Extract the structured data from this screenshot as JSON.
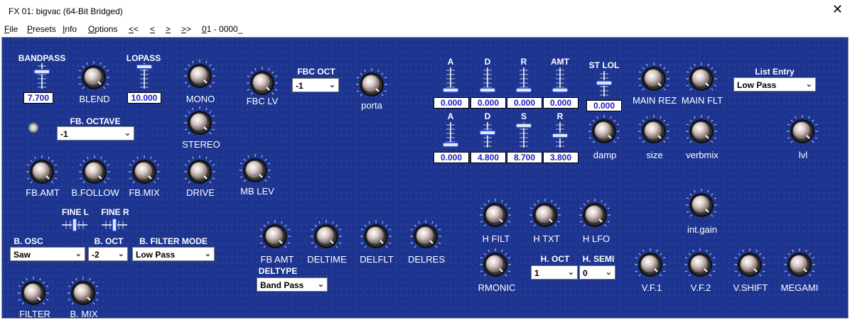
{
  "window": {
    "title": "FX 01: bigvac (64-Bit Bridged)"
  },
  "menu": {
    "file": "File",
    "presets": "Presets",
    "info": "Info",
    "options": "Options",
    "prev2": "<<",
    "prev": "<",
    "next": ">",
    "next2": ">>",
    "preset_num": "01 - 0000_"
  },
  "sliders": {
    "bandpass": {
      "label": "BANDPASS",
      "value": "7.700"
    },
    "lopass": {
      "label": "LOPASS",
      "value": "10.000"
    },
    "env1_a": {
      "label": "A",
      "value": "0.000"
    },
    "env1_d": {
      "label": "D",
      "value": "0.000"
    },
    "env1_r": {
      "label": "R",
      "value": "0.000"
    },
    "env1_amt": {
      "label": "AMT",
      "value": "0.000"
    },
    "env2_a": {
      "label": "A",
      "value": "0.000"
    },
    "env2_d": {
      "label": "D",
      "value": "4.800"
    },
    "env2_s": {
      "label": "S",
      "value": "8.700"
    },
    "env2_r": {
      "label": "R",
      "value": "3.800"
    },
    "st_lol": {
      "label": "ST LOL",
      "value": "0.000"
    },
    "fine_l": {
      "label": "FINE L"
    },
    "fine_r": {
      "label": "FINE R"
    }
  },
  "knobs": {
    "blend": "BLEND",
    "mono": "MONO",
    "stereo": "STEREO",
    "fbc_lv": "FBC LV",
    "porta": "porta",
    "fb_amt": "FB.AMT",
    "b_follow": "B.FOLLOW",
    "fb_mix": "FB.MIX",
    "drive": "DRIVE",
    "mb_lev": "MB LEV",
    "filter": "FILTER",
    "b_mix": "B. MIX",
    "fb_amt2": "FB AMT",
    "deltime": "DELTIME",
    "delflt": "DELFLT",
    "delres": "DELRES",
    "h_filt": "H FILT",
    "h_txt": "H TXT",
    "h_lfo": "H LFO",
    "rmonic": "RMONIC",
    "main_rez": "MAIN REZ",
    "main_flt": "MAIN FLT",
    "damp": "damp",
    "size": "size",
    "verbmix": "verbmix",
    "lvl": "lvl",
    "int_gain": "int.gain",
    "vf1": "V.F.1",
    "vf2": "V.F.2",
    "vshift": "V.SHIFT",
    "megami": "MEGAMI"
  },
  "selects": {
    "fbc_oct": {
      "label": "FBC OCT",
      "value": "-1"
    },
    "fb_octave": {
      "label": "FB. OCTAVE",
      "value": "-1"
    },
    "b_osc": {
      "label": "B. OSC",
      "value": "Saw"
    },
    "b_oct": {
      "label": "B. OCT",
      "value": "-2"
    },
    "b_filter_mode": {
      "label": "B. FILTER MODE",
      "value": "Low Pass"
    },
    "deltype": {
      "label": "DELTYPE",
      "value": "Band Pass"
    },
    "h_oct": {
      "label": "H. OCT",
      "value": "1"
    },
    "h_semi": {
      "label": "H. SEMI",
      "value": "0"
    },
    "list_entry": {
      "label": "List Entry",
      "value": "Low Pass"
    }
  },
  "colors": {
    "panel": "#1d3590",
    "value_text": "#1a1ac8",
    "label": "#ffffff"
  }
}
